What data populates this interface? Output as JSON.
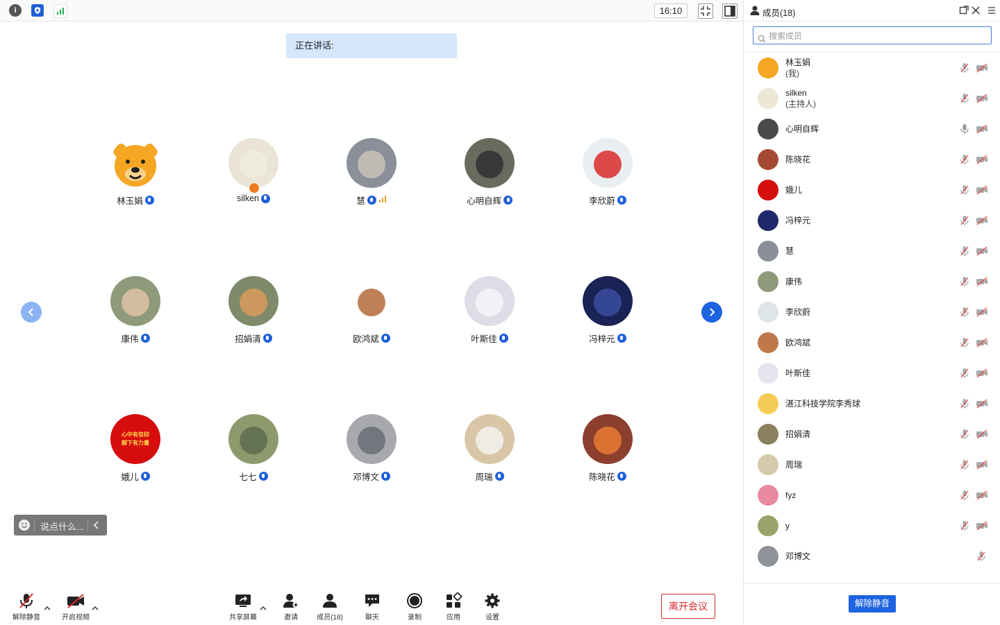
{
  "topbar": {
    "clock": "16:10"
  },
  "speaking": {
    "label": "正在讲话:"
  },
  "grid": [
    {
      "name": "林玉娟",
      "bg": "#ffffff",
      "face": "#f5a623",
      "host": false,
      "signal": false
    },
    {
      "name": "silken",
      "bg": "#e9e4d5",
      "face": "#f1ece0",
      "host": true,
      "signal": false
    },
    {
      "name": "慧",
      "bg": "#8a8f99",
      "face": "#c9c4b9",
      "host": false,
      "signal": true
    },
    {
      "name": "心明自辉",
      "bg": "#6b6a5e",
      "face": "#2f2f35",
      "host": false,
      "signal": false
    },
    {
      "name": "李欣蔚",
      "bg": "#e9eef2",
      "face": "#d92b2b",
      "host": false,
      "signal": false
    },
    {
      "name": "康伟",
      "bg": "#8e9a7a",
      "face": "#e0c2a8",
      "host": false,
      "signal": false
    },
    {
      "name": "招娟清",
      "bg": "#7f8a6a",
      "face": "#d99a5a",
      "host": false,
      "signal": false
    },
    {
      "name": "欧鸿斌",
      "bg": "#ffffff",
      "face": "#b56a3a",
      "host": false,
      "signal": false
    },
    {
      "name": "叶斯佳",
      "bg": "#dcdde6",
      "face": "#f6f6f8",
      "host": false,
      "signal": false
    },
    {
      "name": "冯梓元",
      "bg": "#1a2355",
      "face": "#3b4da0",
      "host": false,
      "signal": false
    },
    {
      "name": "娥儿",
      "bg": "#d60d0d",
      "face": "#d60d0d",
      "host": false,
      "signal": false
    },
    {
      "name": "七七",
      "bg": "#8e9a6e",
      "face": "#5e6b50",
      "host": false,
      "signal": false
    },
    {
      "name": "邓博文",
      "bg": "#a7a9ae",
      "face": "#6a6d74",
      "host": false,
      "signal": false
    },
    {
      "name": "周瑞",
      "bg": "#d9c6a6",
      "face": "#f2f2f0",
      "host": false,
      "signal": false
    },
    {
      "name": "陈晓花",
      "bg": "#8d3f2e",
      "face": "#e67b33",
      "host": false,
      "signal": false
    }
  ],
  "red_avatar_text": "心中有信仰\n脚下有力量",
  "chat": {
    "placeholder": "说点什么..."
  },
  "bottombar": {
    "unmute": "解除静音",
    "video": "开启视频",
    "share": "共享屏幕",
    "invite": "邀请",
    "members": "成员(18)",
    "chat": "聊天",
    "record": "录制",
    "apps": "应用",
    "settings": "设置",
    "leave": "离开会议"
  },
  "panel": {
    "title": "成员(18)",
    "search_placeholder": "搜索成员",
    "unmute_all": "解除静音",
    "members": [
      {
        "name": "林玉娟",
        "sub": "(我)",
        "bg": "#f5a623",
        "mic_on": false,
        "video": true
      },
      {
        "name": "silken",
        "sub": "(主持人)",
        "bg": "#ece6d4",
        "mic_on": false,
        "video": true
      },
      {
        "name": "心明自辉",
        "sub": "",
        "bg": "#4a4a48",
        "mic_on": true,
        "video": true
      },
      {
        "name": "陈晓花",
        "sub": "",
        "bg": "#a54a32",
        "mic_on": false,
        "video": true
      },
      {
        "name": "娥儿",
        "sub": "",
        "bg": "#d60d0d",
        "mic_on": false,
        "video": true
      },
      {
        "name": "冯梓元",
        "sub": "",
        "bg": "#1e2a6a",
        "mic_on": false,
        "video": true
      },
      {
        "name": "慧",
        "sub": "",
        "bg": "#8a8f99",
        "mic_on": false,
        "video": true
      },
      {
        "name": "康伟",
        "sub": "",
        "bg": "#8e9a7a",
        "mic_on": false,
        "video": true
      },
      {
        "name": "李欣蔚",
        "sub": "",
        "bg": "#dfe6ea",
        "mic_on": false,
        "video": true
      },
      {
        "name": "欧鸿斌",
        "sub": "",
        "bg": "#c0784a",
        "mic_on": false,
        "video": true
      },
      {
        "name": "叶斯佳",
        "sub": "",
        "bg": "#e4e4ee",
        "mic_on": false,
        "video": true
      },
      {
        "name": "湛江科技学院李秀球",
        "sub": "",
        "bg": "#f4cc55",
        "mic_on": false,
        "video": true
      },
      {
        "name": "招娟清",
        "sub": "",
        "bg": "#8a7f5e",
        "mic_on": false,
        "video": true
      },
      {
        "name": "周瑞",
        "sub": "",
        "bg": "#d4c9aa",
        "mic_on": false,
        "video": true
      },
      {
        "name": "fyz",
        "sub": "",
        "bg": "#e88aa0",
        "mic_on": false,
        "video": true
      },
      {
        "name": "y",
        "sub": "",
        "bg": "#9aa46a",
        "mic_on": false,
        "video": true
      },
      {
        "name": "邓博文",
        "sub": "",
        "bg": "#8f9299",
        "mic_on": false,
        "video": false
      }
    ]
  }
}
